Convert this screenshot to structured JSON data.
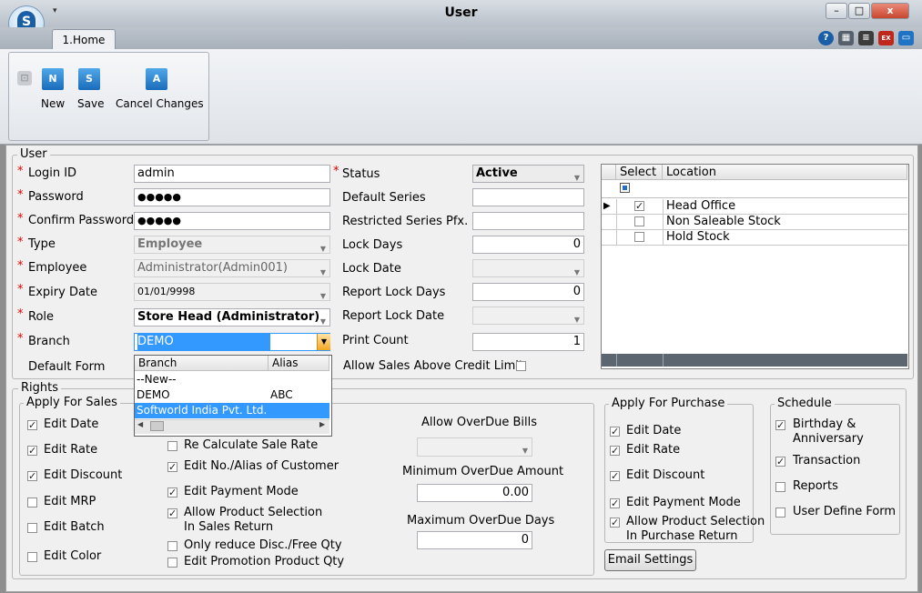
{
  "window": {
    "title": "User",
    "logo_letter": "S",
    "quick_access_glyph": "▾",
    "minimize": "–",
    "maximize": "□",
    "close": "x"
  },
  "ribbon": {
    "tab": "1.Home",
    "buttons": {
      "new_label": "New",
      "new_icon": "N",
      "save_label": "Save",
      "save_icon": "S",
      "cancel_label": "Cancel Changes",
      "cancel_icon": "A"
    },
    "toolbar_icons": [
      "help-icon",
      "calculator-icon",
      "notepad-icon",
      "exit-icon",
      "window-icon"
    ]
  },
  "user": {
    "legend": "User",
    "login_id_label": "Login ID",
    "login_id": "admin",
    "password_label": "Password",
    "password": "●●●●●",
    "confirm_label": "Confirm Password",
    "confirm": "●●●●●",
    "type_label": "Type",
    "type": "Employee",
    "employee_label": "Employee",
    "employee": "Administrator(Admin001)",
    "expiry_label": "Expiry Date",
    "expiry": "01/01/9998",
    "role_label": "Role",
    "role": "Store Head (Administrator)",
    "branch_label": "Branch",
    "branch": "DEMO",
    "default_form_label": "Default Form",
    "status_label": "Status",
    "status": "Active",
    "default_series_label": "Default Series",
    "default_series": "",
    "restricted_label": "Restricted Series Pfx.",
    "restricted": "",
    "lock_days_label": "Lock Days",
    "lock_days": "0",
    "lock_date_label": "Lock Date",
    "report_lock_days_label": "Report Lock Days",
    "report_lock_days": "0",
    "report_lock_date_label": "Report Lock Date",
    "print_count_label": "Print Count",
    "print_count": "1",
    "allow_sales_credit_label": "Allow Sales Above Credit Limit",
    "allow_sales_credit": false,
    "required_mark": "*"
  },
  "branch_popup": {
    "headers": [
      "Branch",
      "Alias"
    ],
    "rows": [
      {
        "branch": "--New--",
        "alias": ""
      },
      {
        "branch": "DEMO",
        "alias": "ABC"
      },
      {
        "branch": "Softworld India Pvt. Ltd.",
        "alias": ""
      }
    ],
    "selected_index": 2
  },
  "location_grid": {
    "headers": [
      "Select",
      "Location"
    ],
    "rows": [
      {
        "checked": true,
        "name": "Head Office"
      },
      {
        "checked": false,
        "name": "Non Saleable Stock"
      },
      {
        "checked": false,
        "name": "Hold Stock"
      }
    ]
  },
  "rights": {
    "legend": "Rights",
    "sales": {
      "legend": "Apply For Sales",
      "left": [
        {
          "label": "Edit Date",
          "checked": true
        },
        {
          "label": "Edit Rate",
          "checked": true
        },
        {
          "label": "Edit Discount",
          "checked": true
        },
        {
          "label": "Edit MRP",
          "checked": false
        },
        {
          "label": "Edit Batch",
          "checked": false
        },
        {
          "label": "Edit Color",
          "checked": false
        }
      ],
      "right": [
        {
          "label": "Re Calculate Sale Rate",
          "checked": false
        },
        {
          "label": "Edit No./Alias of Customer",
          "checked": true
        },
        {
          "label": "Edit Payment Mode",
          "checked": true
        },
        {
          "label": "Allow Product Selection\nIn Sales Return",
          "checked": true
        },
        {
          "label": "Only reduce Disc./Free Qty",
          "checked": false
        },
        {
          "label": "Edit Promotion Product Qty",
          "checked": false
        }
      ]
    },
    "overdue": {
      "allow_label": "Allow OverDue Bills",
      "min_label": "Minimum OverDue Amount",
      "min_value": "0.00",
      "max_label": "Maximum OverDue Days",
      "max_value": "0"
    },
    "purchase": {
      "legend": "Apply For Purchase",
      "items": [
        {
          "label": "Edit Date",
          "checked": true
        },
        {
          "label": "Edit Rate",
          "checked": true
        },
        {
          "label": "Edit Discount",
          "checked": true
        },
        {
          "label": "Edit Payment Mode",
          "checked": true
        },
        {
          "label": "Allow Product Selection\nIn Purchase Return",
          "checked": true
        }
      ]
    },
    "schedule": {
      "legend": "Schedule",
      "items": [
        {
          "label": "Birthday &\nAnniversary",
          "checked": true
        },
        {
          "label": "Transaction",
          "checked": true
        },
        {
          "label": "Reports",
          "checked": false
        },
        {
          "label": "User Define Form",
          "checked": false
        }
      ]
    },
    "email_button": "Email Settings"
  },
  "colors": {
    "accent": "#3399ff",
    "required": "#dd0000",
    "ribbon_icon": "#1a6cbb"
  }
}
